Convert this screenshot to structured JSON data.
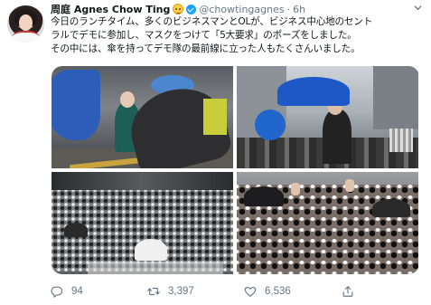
{
  "tweet": {
    "author_name": "周庭 Agnes Chow Ting",
    "handle": "@chowtingagnes",
    "separator": "·",
    "time": "6h",
    "lines": [
      "今日のランチタイム、多くのビジネスマンとOLが、ビジネス中心地のセント",
      "ラルでデモに参加し、マスクをつけて「5大要求」のポーズをしました。",
      "その中には、傘を持ってデモ隊の最前線に立った人もたくさんいました。"
    ]
  },
  "icons": {
    "author_emoji": "grinning-face-emoji",
    "verified": "verified-badge-icon",
    "menu": "chevron-down-icon",
    "reply": "reply-bubble-icon",
    "retweet": "retweet-icon",
    "like": "heart-icon",
    "share": "share-icon"
  },
  "actions": {
    "reply_count": "94",
    "retweet_count": "3,397",
    "like_count": "6,536"
  },
  "colors": {
    "accent": "#1da1f2",
    "text": "#14171a",
    "secondary": "#657786"
  }
}
